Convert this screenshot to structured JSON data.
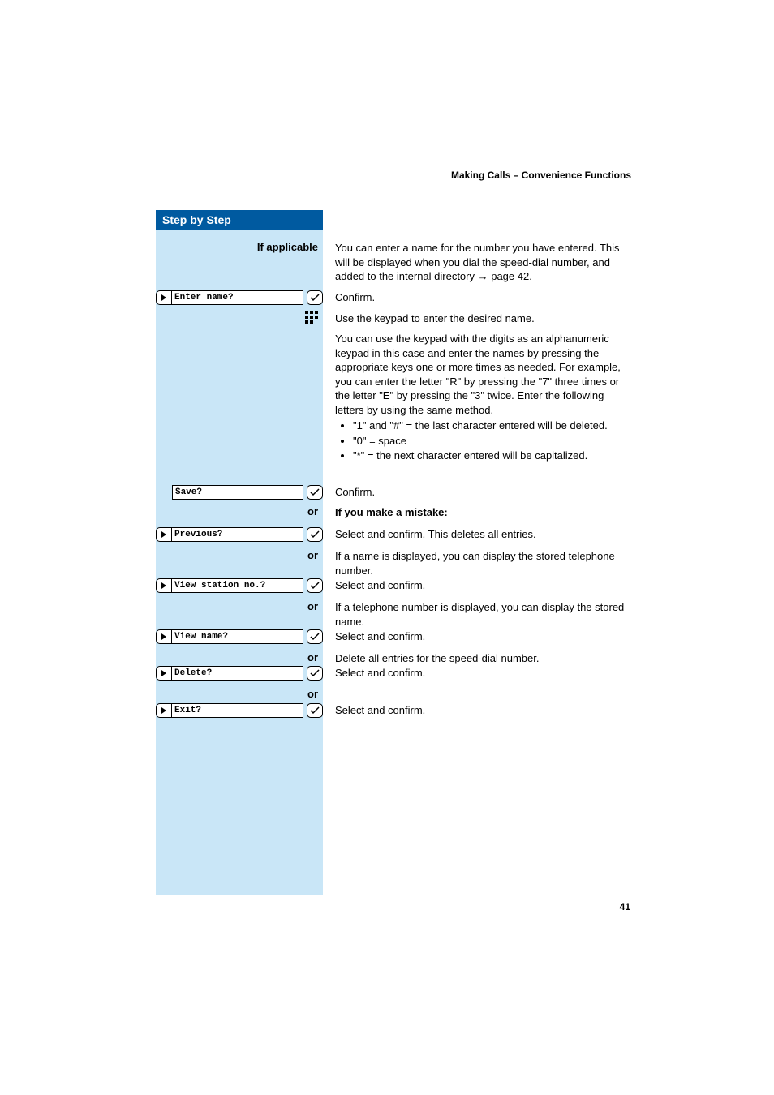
{
  "running_head": "Making Calls – Convenience Functions",
  "sidebar_title": "Step by Step",
  "page_number": "41",
  "if_applicable": "If applicable",
  "or": "or",
  "intro": {
    "line1": "You can enter a name for the number you have entered. This will be displayed when you dial the speed-dial number, and added to the internal directory ",
    "arrow": "→",
    "page_ref": " page 42."
  },
  "display": {
    "enter_name": "Enter name?",
    "save": "Save?",
    "previous": "Previous?",
    "view_station": "View station no.?",
    "view_name": "View name?",
    "delete": "Delete?",
    "exit": "Exit?"
  },
  "text": {
    "confirm": "Confirm.",
    "use_keypad": "Use the keypad to enter the desired name.",
    "para_alpha": "You can use the keypad with the digits as an alphanumeric keypad in this case and enter the names by pressing the appropriate keys one or more times as needed. For example, you can enter the letter \"R\" by pressing the \"7\" three times or the letter \"E\" by pressing the \"3\" twice. Enter the following letters by using the same method.",
    "bul1": "\"1\" and \"#\" = the last character entered will be deleted.",
    "bul2": "\"0\" = space",
    "bul3": "\"*\" = the next character entered will be capitalized.",
    "mistake": "If you make a mistake:",
    "select_confirm_deletes": "Select and confirm. This deletes all entries.",
    "if_name_displayed": "If a name is displayed, you can display the stored telephone number.",
    "select_confirm": "Select and confirm.",
    "if_tel_displayed": "If a telephone number is displayed, you can display the stored name.",
    "delete_all": "Delete all entries for the speed-dial number."
  },
  "icons": {
    "arrow_right": "arrow-right-icon",
    "confirm_check": "confirm-check-icon",
    "keypad": "keypad-icon"
  }
}
